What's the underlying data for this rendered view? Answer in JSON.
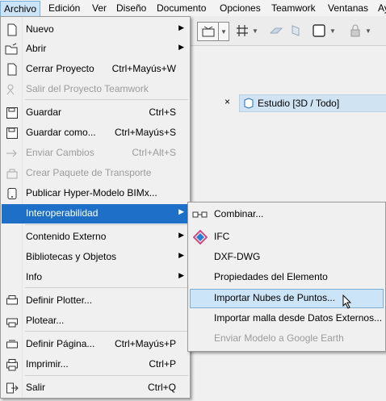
{
  "menubar": {
    "items": [
      "Archivo",
      "Edición",
      "Ver",
      "Diseño",
      "Documento",
      "Opciones",
      "Teamwork",
      "Ventanas",
      "Ay"
    ]
  },
  "tab": {
    "close": "×",
    "label": "Estudio [3D / Todo]"
  },
  "menu": {
    "nuevo": "Nuevo",
    "abrir": "Abrir",
    "cerrar": "Cerrar Proyecto",
    "cerrar_sc": "Ctrl+Mayús+W",
    "salir_teamwork": "Salir del Proyecto Teamwork",
    "guardar": "Guardar",
    "guardar_sc": "Ctrl+S",
    "guardar_como": "Guardar como...",
    "guardar_como_sc": "Ctrl+Mayús+S",
    "enviar": "Enviar Cambios",
    "enviar_sc": "Ctrl+Alt+S",
    "paquete": "Crear Paquete de Transporte",
    "bimx": "Publicar Hyper-Modelo BIMx...",
    "interop": "Interoperabilidad",
    "contenido": "Contenido Externo",
    "bibliotecas": "Bibliotecas y Objetos",
    "info": "Info",
    "plotter": "Definir Plotter...",
    "plotear": "Plotear...",
    "pagina": "Definir Página...",
    "pagina_sc": "Ctrl+Mayús+P",
    "imprimir": "Imprimir...",
    "imprimir_sc": "Ctrl+P",
    "salir": "Salir",
    "salir_sc": "Ctrl+Q"
  },
  "submenu": {
    "combinar": "Combinar...",
    "ifc": "IFC",
    "dxf": "DXF-DWG",
    "propiedades": "Propiedades del Elemento",
    "nubes": "Importar Nubes de Puntos...",
    "malla": "Importar malla desde Datos Externos...",
    "google": "Enviar Modelo a Google Earth"
  },
  "colors": {
    "highlight": "#1e6fc8",
    "hover": "#cce4f7",
    "disabled": "#9b9b9b"
  }
}
